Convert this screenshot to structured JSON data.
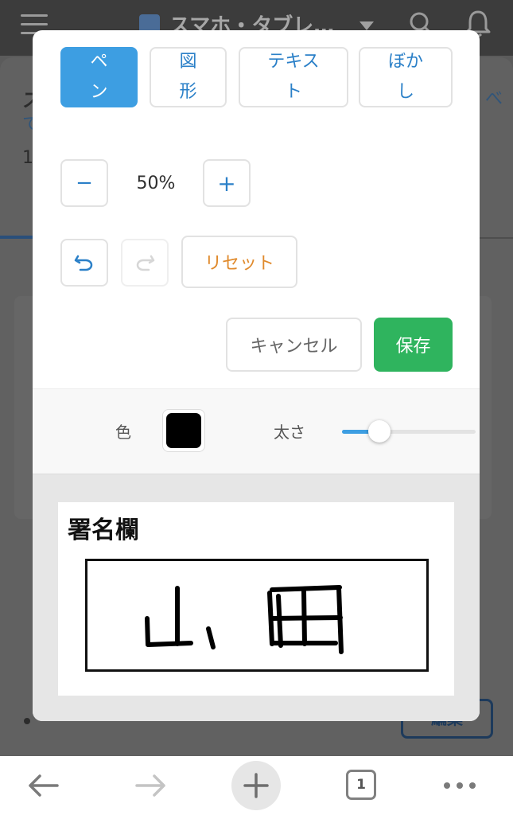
{
  "app_bar": {
    "title": "スマホ・タブレ…",
    "menu_icon": "hamburger-icon",
    "search_icon": "search-icon",
    "notification_icon": "bell-icon"
  },
  "background_page": {
    "heading_fragment": "ス",
    "link_fragment_left": "て",
    "link_fragment_right": "べ",
    "count_fragment": "1",
    "edit_button_label": "編集"
  },
  "editor": {
    "tools": [
      {
        "label": "ペ\nン",
        "active": true
      },
      {
        "label": "図\n形",
        "active": false
      },
      {
        "label": "テキス\nト",
        "active": false
      },
      {
        "label": "ぼか\nし",
        "active": false
      }
    ],
    "zoom": {
      "value": "50%",
      "minus_label": "−",
      "plus_label": "+"
    },
    "history": {
      "undo_icon": "undo-icon",
      "redo_icon": "redo-icon",
      "redo_enabled": false
    },
    "reset_label": "リセット",
    "cancel_label": "キャンセル",
    "save_label": "保存",
    "properties": {
      "color_label": "色",
      "color_value": "#000000",
      "width_label": "太さ",
      "width_level": 0.28
    },
    "canvas": {
      "title": "署名欄",
      "signature_text": "山田"
    }
  },
  "browser_bar": {
    "back_icon": "arrow-left-icon",
    "forward_icon": "arrow-right-icon",
    "new_tab_icon": "plus-icon",
    "tab_count": "1",
    "more_icon": "more-horizontal-icon"
  },
  "colors": {
    "primary": "#3d9ee2",
    "link": "#2b80c8",
    "warning": "#e08a2c",
    "success": "#2fb45e"
  }
}
